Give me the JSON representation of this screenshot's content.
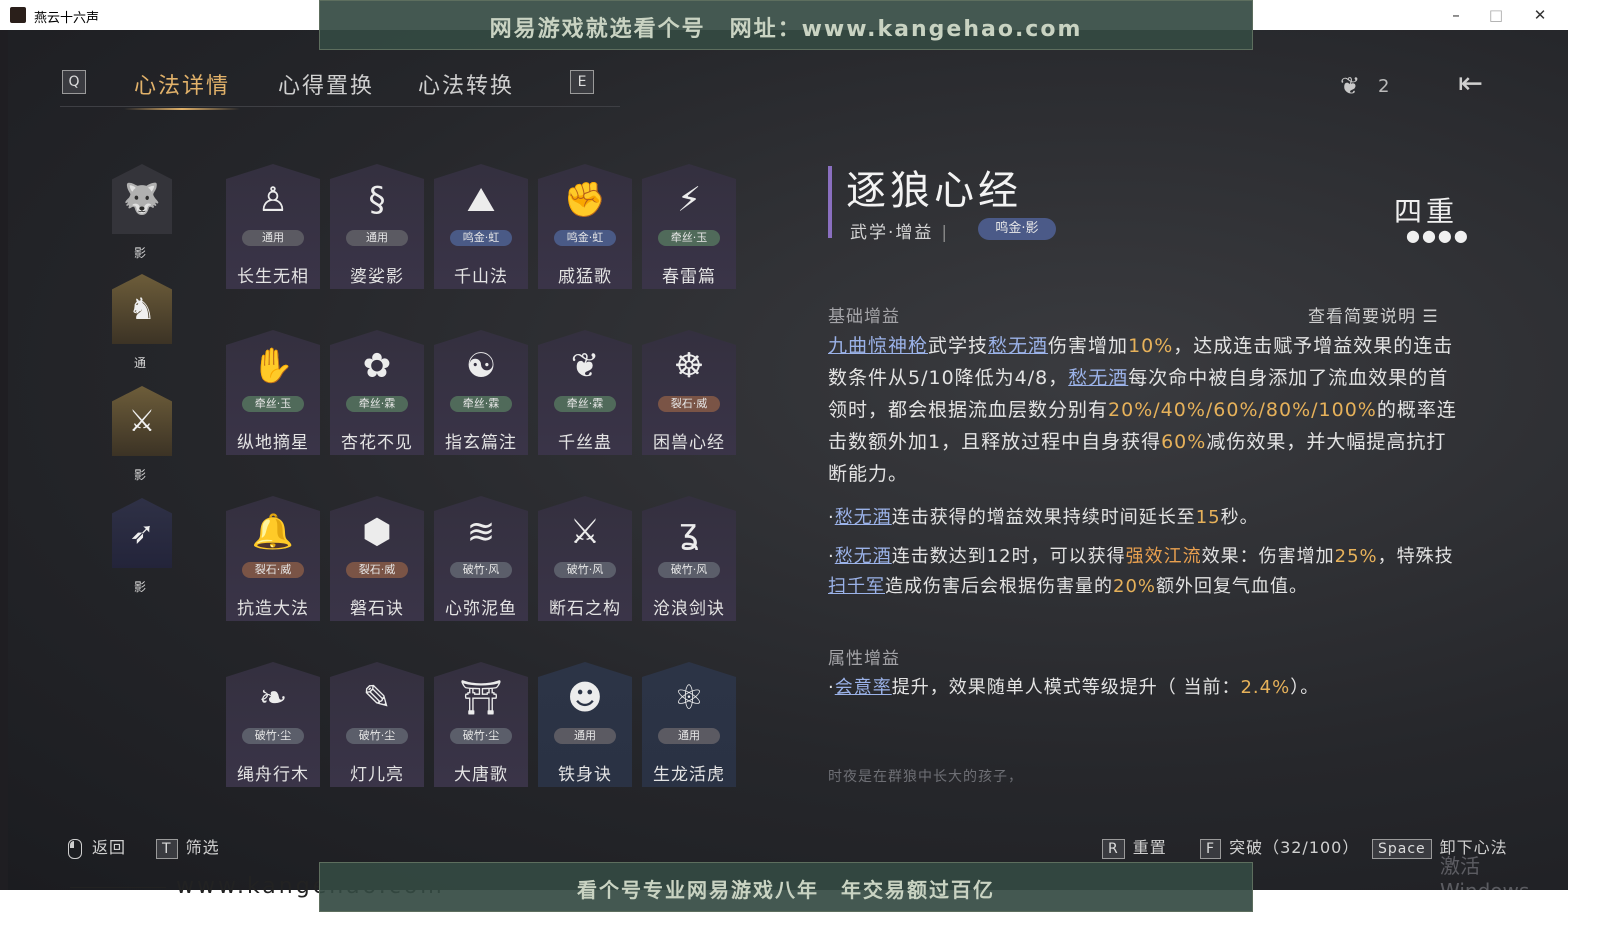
{
  "window": {
    "title": "燕云十六声",
    "minimize": "–",
    "maximize": "□",
    "close": "✕"
  },
  "watermark": {
    "top_banner": "网易游戏就选看个号　网址：www.kangehao.com",
    "bottom_banner": "看个号专业网易游戏八年　年交易额过百亿",
    "site_url": "www.kangehao.com",
    "windows_activation": "激活 Windows"
  },
  "nav": {
    "left_key": "Q",
    "right_key": "E",
    "tabs": [
      {
        "label": "心法详情",
        "active": true
      },
      {
        "label": "心得置换",
        "active": false
      },
      {
        "label": "心法转换",
        "active": false
      }
    ],
    "feather_count": "2"
  },
  "categories": [
    {
      "tag": "影",
      "icon": "wolf-icon",
      "selected": true
    },
    {
      "tag": "通",
      "icon": "horse-icon",
      "selected": false
    },
    {
      "tag": "影",
      "icon": "crossed-spears-icon",
      "selected": false
    },
    {
      "tag": "影",
      "icon": "bow-icon",
      "selected": false
    }
  ],
  "cards": [
    {
      "name": "长生无相",
      "badge": "通用",
      "badge_type": "general",
      "icon": "statue-icon",
      "glyph": "♙"
    },
    {
      "name": "婆娑影",
      "badge": "通用",
      "badge_type": "general",
      "icon": "dragon-icon",
      "glyph": "§"
    },
    {
      "name": "千山法",
      "badge": "鸣金·虹",
      "badge_type": "ming",
      "icon": "mountain-icon",
      "glyph": "⛰"
    },
    {
      "name": "戚猛歌",
      "badge": "鸣金·虹",
      "badge_type": "ming",
      "icon": "gauntlet-icon",
      "glyph": "✊"
    },
    {
      "name": "春雷篇",
      "badge": "牵丝·玉",
      "badge_type": "qian",
      "icon": "storm-tree-icon",
      "glyph": "⚡"
    },
    {
      "name": "纵地摘星",
      "badge": "牵丝·玉",
      "badge_type": "qian",
      "icon": "hand-orb-icon",
      "glyph": "✋"
    },
    {
      "name": "杏花不见",
      "badge": "牵丝·霖",
      "badge_type": "qian",
      "icon": "flower-icon",
      "glyph": "✿"
    },
    {
      "name": "指玄篇注",
      "badge": "牵丝·霖",
      "badge_type": "qian",
      "icon": "yinyang-icon",
      "glyph": "☯"
    },
    {
      "name": "千丝蛊",
      "badge": "牵丝·霖",
      "badge_type": "qian",
      "icon": "leaf-icon",
      "glyph": "❦"
    },
    {
      "name": "困兽心经",
      "badge": "裂石·威",
      "badge_type": "lie",
      "icon": "trap-icon",
      "glyph": "☸"
    },
    {
      "name": "抗造大法",
      "badge": "裂石·威",
      "badge_type": "lie",
      "icon": "bell-icon",
      "glyph": "🔔"
    },
    {
      "name": "磐石诀",
      "badge": "裂石·威",
      "badge_type": "lie",
      "icon": "rock-icon",
      "glyph": "⬢"
    },
    {
      "name": "心弥泥鱼",
      "badge": "破竹·风",
      "badge_type": "po",
      "icon": "fish-icon",
      "glyph": "≋"
    },
    {
      "name": "断石之构",
      "badge": "破竹·风",
      "badge_type": "po",
      "icon": "swordsman-icon",
      "glyph": "⚔"
    },
    {
      "name": "沧浪剑诀",
      "badge": "破竹·风",
      "badge_type": "po",
      "icon": "serpent-icon",
      "glyph": "ʓ"
    },
    {
      "name": "绳舟行木",
      "badge": "破竹·尘",
      "badge_type": "po",
      "icon": "roots-icon",
      "glyph": "❧"
    },
    {
      "name": "灯儿亮",
      "badge": "破竹·尘",
      "badge_type": "po",
      "icon": "lantern-icon",
      "glyph": "✎"
    },
    {
      "name": "大唐歌",
      "badge": "破竹·尘",
      "badge_type": "po",
      "icon": "palace-icon",
      "glyph": "⛩"
    },
    {
      "name": "铁身诀",
      "badge": "通用",
      "badge_type": "general",
      "icon": "muscle-icon",
      "glyph": "☻"
    },
    {
      "name": "生龙活虎",
      "badge": "通用",
      "badge_type": "general",
      "icon": "swirl-icon",
      "glyph": "⚛"
    }
  ],
  "detail": {
    "title": "逐狼心经",
    "subtitle": "武学·增益",
    "tag": "鸣金·影",
    "rank": "四重",
    "rank_dots": "●●●●",
    "basic_title": "基础增益",
    "toggle_label": "查看简要说明",
    "p1": {
      "a": "九曲惊神枪",
      "b": "武学技",
      "c": "愁无酒",
      "d": "伤害增加",
      "e": "10%",
      "f": "，达成连击赋予增益效果的连击数条件从5/10降低为4/8，",
      "g": "愁无酒",
      "h": "每次命中被自身添加了流血效果的首领时，都会根据流血层数分别有",
      "i": "20%/40%/60%/80%/100%",
      "j": "的概率连击数额外加1，且释放过程中自身获得",
      "k": "60%",
      "l": "减伤效果，并大幅提高抗打断能力。"
    },
    "p2": {
      "a": "·",
      "b": "愁无酒",
      "c": "连击获得的增益效果持续时间延长至",
      "d": "15",
      "e": "秒。"
    },
    "p3": {
      "a": "·",
      "b": "愁无酒",
      "c": "连击数达到12时，可以获得",
      "d": "强效江流",
      "e": "效果：伤害增加",
      "f": "25%",
      "g": "，特殊技",
      "h": "扫千军",
      "i": "造成伤害后会根据伤害量的",
      "j": "20%",
      "k": "额外回复气血值。"
    },
    "attr_title": "属性增益",
    "p4": {
      "a": "·",
      "b": "会意率",
      "c": "提升，效果随单人模式等级提升（ 当前：",
      "d": "2.4%",
      "e": "）。"
    },
    "quote": "时夜是在群狼中长大的孩子，"
  },
  "footer": {
    "back": "返回",
    "filter_key": "T",
    "filter": "筛选",
    "reset_key": "R",
    "reset": "重置",
    "break_key": "F",
    "break": "突破（32/100）",
    "unload_key": "Space",
    "unload": "卸下心法"
  },
  "colors": {
    "accent_gold": "#e2b26a",
    "link_blue": "#9bb2e8",
    "value_gold": "#e6b15a"
  }
}
